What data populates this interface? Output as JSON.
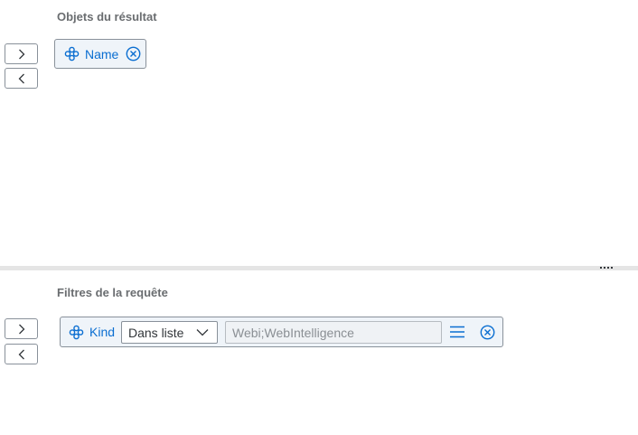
{
  "result_objects": {
    "title": "Objets du résultat",
    "tokens": [
      {
        "label": "Name",
        "icon": "dimension-icon",
        "remove_icon": "remove-circle-icon"
      }
    ]
  },
  "query_filters": {
    "title": "Filtres de la requête",
    "filter": {
      "object_label": "Kind",
      "object_icon": "dimension-icon",
      "operator": "Dans liste",
      "value_placeholder": "Webi;WebIntelligence",
      "list_icon": "list-menu-icon",
      "remove_icon": "remove-circle-icon"
    }
  },
  "buttons": {
    "add_icon": "chevron-right-icon",
    "remove_icon": "chevron-left-icon"
  },
  "colors": {
    "accent": "#0a6ed1",
    "token_bg": "#eff4f9",
    "title_gray": "#6a6d70"
  }
}
